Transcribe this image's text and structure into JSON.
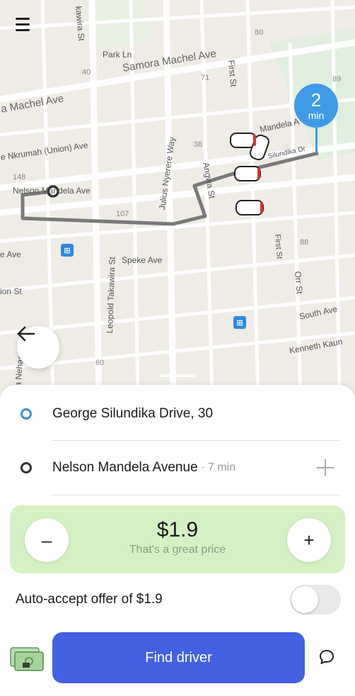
{
  "map": {
    "streets": [
      "Samora Machel Ave",
      "a Machel Ave",
      "Park Ln",
      "e Nkrumah (Union) Ave",
      "Julius Nyerere Way",
      "First St",
      "Angwa St",
      "Leopold Takawira St",
      "Speke Ave",
      "e Ave",
      "ion St",
      "Orr St",
      "South Ave",
      "Kenneth Kaun",
      "a Nehanda St",
      "kawira St",
      "Nelson Mandela Ave",
      "Mandela A",
      "Silundika Dr",
      "First St"
    ],
    "numbers": [
      "80",
      "40",
      "71",
      "89",
      "38",
      "148",
      "107",
      "88",
      "60"
    ],
    "eta": {
      "value": "2",
      "unit": "min"
    },
    "colors": {
      "eta": "#3f9be6",
      "route": "#7a7a7a"
    }
  },
  "header": {
    "menu_icon": "hamburger-icon"
  },
  "route": {
    "pickup": "George Silundika Drive, 30",
    "destination": "Nelson Mandela Avenue",
    "destination_eta": "7 min",
    "separator": "·"
  },
  "price": {
    "value": "$1.9",
    "hint": "That's a great price",
    "decrease": "–",
    "increase": "+",
    "bg_color": "#d4f1c4"
  },
  "auto_accept": {
    "label": "Auto-accept offer of $1.9",
    "enabled": false
  },
  "actions": {
    "find_driver": "Find driver",
    "button_color": "#4361e3"
  }
}
